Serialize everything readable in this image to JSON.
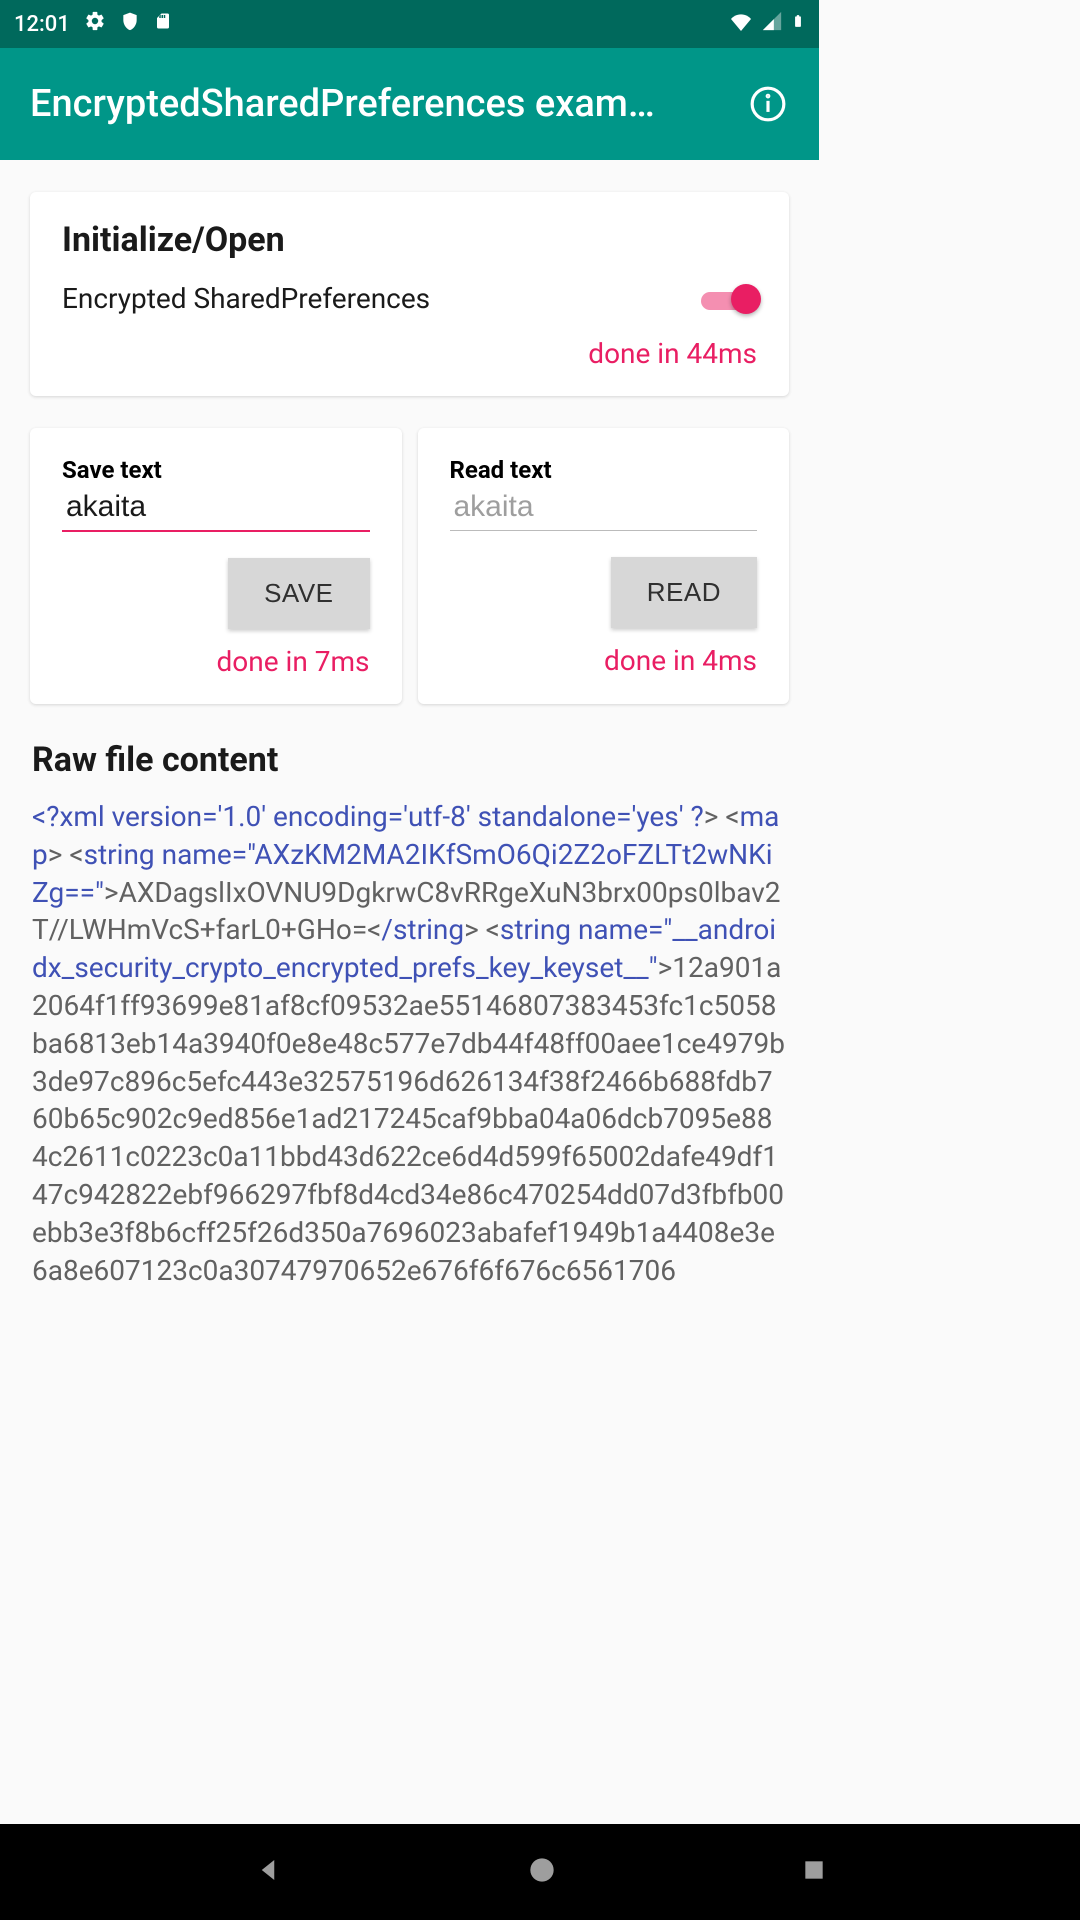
{
  "status_bar": {
    "time": "12:01"
  },
  "app_bar": {
    "title": "EncryptedSharedPreferences exam…"
  },
  "card_init": {
    "title": "Initialize/Open",
    "toggle_label": "Encrypted SharedPreferences",
    "toggle_on": true,
    "status": "done in 44ms"
  },
  "card_save": {
    "title": "Save text",
    "input_value": "akaita",
    "button": "SAVE",
    "status": "done in 7ms"
  },
  "card_read": {
    "title": "Read text",
    "output_value": "akaita",
    "button": "READ",
    "status": "done in 4ms"
  },
  "raw": {
    "title": "Raw file content",
    "p1_a": "<?xml version='1.0' encoding='utf-8' standalone='yes' ?",
    "p1_b": "> <",
    "p1_c": "map",
    "p1_d": "> <",
    "p1_e": "string name=\"AXzKM2MA2IKfSmO6Qi2Z2oFZLTt2wNKiZg==\"",
    "p1_f": ">AXDagslIxOVNU9DgkrwC8vRRgeXuN3brx00ps0lbav2T//LWHmVcS+farL0+GHo=<",
    "p1_g": "/string",
    "p1_h": "> <",
    "p1_i": "string name=\"__androidx_security_crypto_encrypted_prefs_key_keyset__\"",
    "p1_j": ">12a901a2064f1ff93699e81af8cf09532ae55146807383453fc1c5058ba6813eb14a3940f0e8e48c577e7db44f48ff00aee1ce4979b3de97c896c5efc443e32575196d626134f38f2466b688fdb760b65c902c9ed856e1ad217245caf9bba04a06dcb7095e884c2611c0223c0a11bbd43d622ce6d4d599f65002dafe49df147c942822ebf966297fbf8d4cd34e86c470254dd07d3fbfb00ebb3e3f8b6cff25f26d350a7696023abafef1949b1a4408e3e6a8e607123c0a30747970652e676f6f676c6561706"
  }
}
